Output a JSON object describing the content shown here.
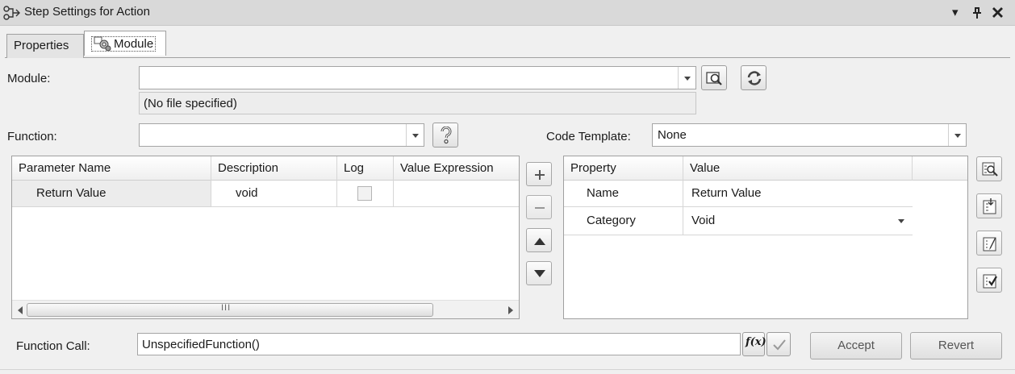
{
  "window": {
    "title": "Step Settings for Action",
    "controls": {
      "dropdown": "▾",
      "pin": "ᵖ",
      "close": "✕"
    }
  },
  "tabs": [
    {
      "label": "Properties",
      "active": false
    },
    {
      "label": "Module",
      "active": true
    }
  ],
  "module": {
    "label": "Module:",
    "value": "",
    "status": "(No file specified)"
  },
  "function": {
    "label": "Function:",
    "value": ""
  },
  "code_template": {
    "label": "Code Template:",
    "value": "None"
  },
  "param_grid": {
    "columns": [
      "Parameter Name",
      "Description",
      "Log",
      "Value Expression"
    ],
    "rows": [
      {
        "name": "Return Value",
        "description": "void",
        "log": false,
        "value_expression": ""
      }
    ],
    "scroll_grip": "III"
  },
  "prop_grid": {
    "columns": [
      "Property",
      "Value"
    ],
    "rows": [
      {
        "property": "Name",
        "value": "Return Value"
      },
      {
        "property": "Category",
        "value": "Void"
      }
    ]
  },
  "function_call": {
    "label": "Function Call:",
    "value": "UnspecifiedFunction()",
    "fx_label": "f(x)"
  },
  "buttons": {
    "accept": "Accept",
    "revert": "Revert"
  },
  "colors": {
    "titlebar": "#d9d9d9",
    "background": "#f0f0f0",
    "selected_row": "#ececec"
  }
}
